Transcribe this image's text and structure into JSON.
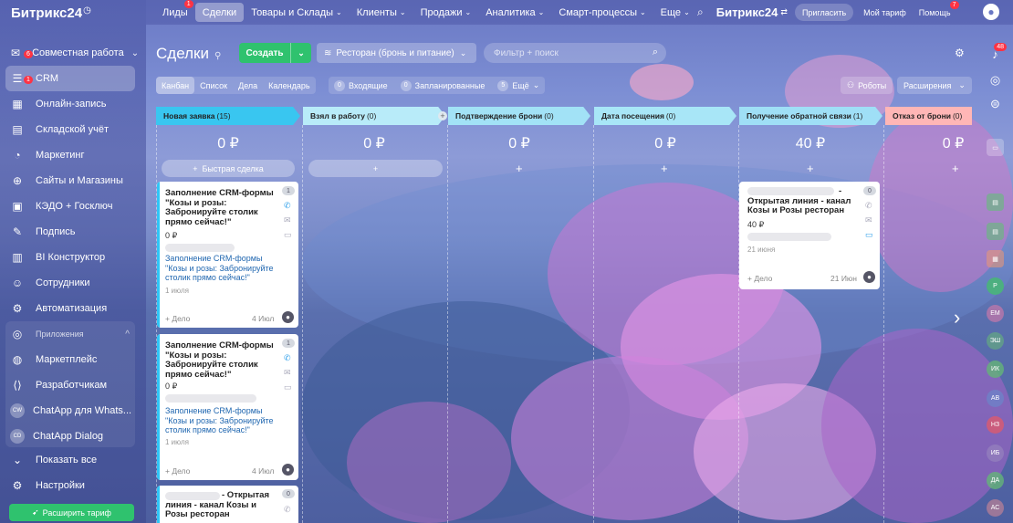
{
  "app": {
    "logo": "Битрикс",
    "logo_ver": "24",
    "logo_mark": "◷"
  },
  "sidebar": {
    "items": [
      {
        "label": "Совместная работа",
        "icon": "chat-bubbles-icon",
        "badge": "6",
        "chevron": "⌄"
      },
      {
        "label": "CRM",
        "icon": "crm-filter-icon",
        "badge": "1"
      },
      {
        "label": "Онлайн-запись",
        "icon": "calendar-icon"
      },
      {
        "label": "Складской учёт",
        "icon": "warehouse-icon"
      },
      {
        "label": "Маркетинг",
        "icon": "megaphone-icon"
      },
      {
        "label": "Сайты и Магазины",
        "icon": "globe-icon"
      },
      {
        "label": "КЭДО + Госключ",
        "icon": "document-key-icon"
      },
      {
        "label": "Подпись",
        "icon": "signature-icon"
      },
      {
        "label": "BI Конструктор",
        "icon": "bar-chart-icon"
      },
      {
        "label": "Сотрудники",
        "icon": "people-icon"
      },
      {
        "label": "Автоматизация",
        "icon": "robot-icon"
      }
    ],
    "apps_section": {
      "label": "Приложения",
      "chevron": "^"
    },
    "apps": [
      {
        "label": "Маркетплейс",
        "icon": "marketplace-icon"
      },
      {
        "label": "Разработчикам",
        "icon": "code-icon"
      },
      {
        "label": "ChatApp для Whats...",
        "avatar": "CW"
      },
      {
        "label": "ChatApp Dialog",
        "avatar": "CD"
      }
    ],
    "show_all": "Показать все",
    "settings": "Настройки",
    "upgrade": "Расширить тариф"
  },
  "topnav": {
    "items": [
      {
        "label": "Лиды",
        "badge": "1"
      },
      {
        "label": "Сделки",
        "active": true
      },
      {
        "label": "Товары и Склады",
        "dd": "⌄"
      },
      {
        "label": "Клиенты",
        "dd": "⌄"
      },
      {
        "label": "Продажи",
        "dd": "⌄"
      },
      {
        "label": "Аналитика",
        "dd": "⌄"
      },
      {
        "label": "Смарт-процессы",
        "dd": "⌄"
      },
      {
        "label": "Еще",
        "dd": "⌄"
      }
    ],
    "brand": "Битрикс24",
    "invite": "Пригласить",
    "tariff": "Мой тариф",
    "help": "Помощь",
    "help_badge": "7"
  },
  "header": {
    "title": "Сделки",
    "create": "Создать",
    "funnel": "Ресторан (бронь и питание)",
    "search_placeholder": "Фильтр + поиск"
  },
  "views": [
    "Канбан",
    "Список",
    "Дела",
    "Календарь"
  ],
  "counters": [
    {
      "n": "0",
      "label": "Входящие"
    },
    {
      "n": "0",
      "label": "Запланированные"
    },
    {
      "n": "5",
      "label": "Ещё"
    }
  ],
  "right_buttons": {
    "robots": "Роботы",
    "extensions": "Расширения"
  },
  "stages": [
    {
      "name": "Новая заявка",
      "count": "(15)",
      "color": "#39c6f0",
      "sum": "0 ₽"
    },
    {
      "name": "Взял в работу",
      "count": "(0)",
      "color": "#b8ebf9",
      "sum": "0 ₽"
    },
    {
      "name": "Подтверждение брони",
      "count": "(0)",
      "color": "#a2e2f6",
      "sum": "0 ₽"
    },
    {
      "name": "Дата посещения",
      "count": "(0)",
      "color": "#a8e6f7",
      "sum": "0 ₽"
    },
    {
      "name": "Получение обратной связи",
      "count": "(1)",
      "color": "#9fdff6",
      "sum": "40 ₽"
    },
    {
      "name": "Отказ от брони",
      "count": "(0)",
      "color": "#ffb6b6",
      "sum": "0 ₽"
    }
  ],
  "quick_deal": "Быстрая сделка",
  "cards": [
    {
      "title": "Заполнение CRM-формы \"Козы и розы: Забронируйте столик прямо сейчас!\"",
      "sum": "0 ₽",
      "link": "Заполнение CRM-формы \"Козы и розы: Забронируйте столик прямо сейчас!\"",
      "date": "1 июля",
      "add": "+ Дело",
      "dt": "4 Июл",
      "badge": "1"
    },
    {
      "title": "Заполнение CRM-формы \"Козы и розы: Забронируйте столик прямо сейчас!\"",
      "sum": "0 ₽",
      "link": "Заполнение CRM-формы \"Козы и розы: Забронируйте столик прямо сейчас!\"",
      "date": "1 июля",
      "add": "+ Дело",
      "dt": "4 Июл",
      "badge": "1"
    },
    {
      "title": "- Открытая линия - канал Козы и Розы ресторан",
      "badge": "0"
    },
    {
      "title": "- Открытая линия - канал Козы и Розы ресторан",
      "sum": "40 ₽",
      "date": "21 июня",
      "add": "+ Дело",
      "dt": "21 Июн",
      "badge": "0"
    }
  ],
  "rail": {
    "notif_badge": "48",
    "avatars": [
      "Р",
      "ЕМ",
      "ЭШ",
      "ИК",
      "АВ",
      "НЗ",
      "ИБ",
      "ДА",
      "АС"
    ]
  }
}
